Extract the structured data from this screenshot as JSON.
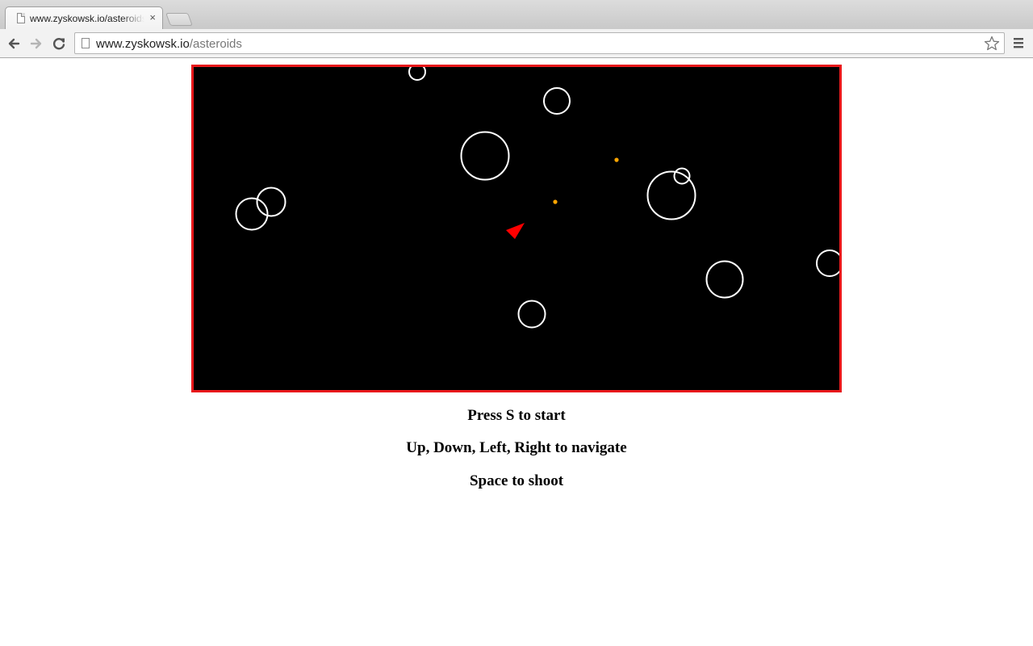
{
  "browser": {
    "tab_title": "www.zyskowsk.io/asteroids",
    "tab_close_label": "×",
    "url_host": "www.zyskowsk.io",
    "url_path": "/asteroids"
  },
  "game": {
    "ship_color": "#ff0000",
    "bullet_color": "#ffa500",
    "asteroid_stroke": "#ffffff",
    "border_color": "#e8181b"
  },
  "instructions": {
    "start": "Press S to start",
    "navigate": "Up, Down, Left, Right to navigate",
    "shoot": "Space to shoot"
  }
}
